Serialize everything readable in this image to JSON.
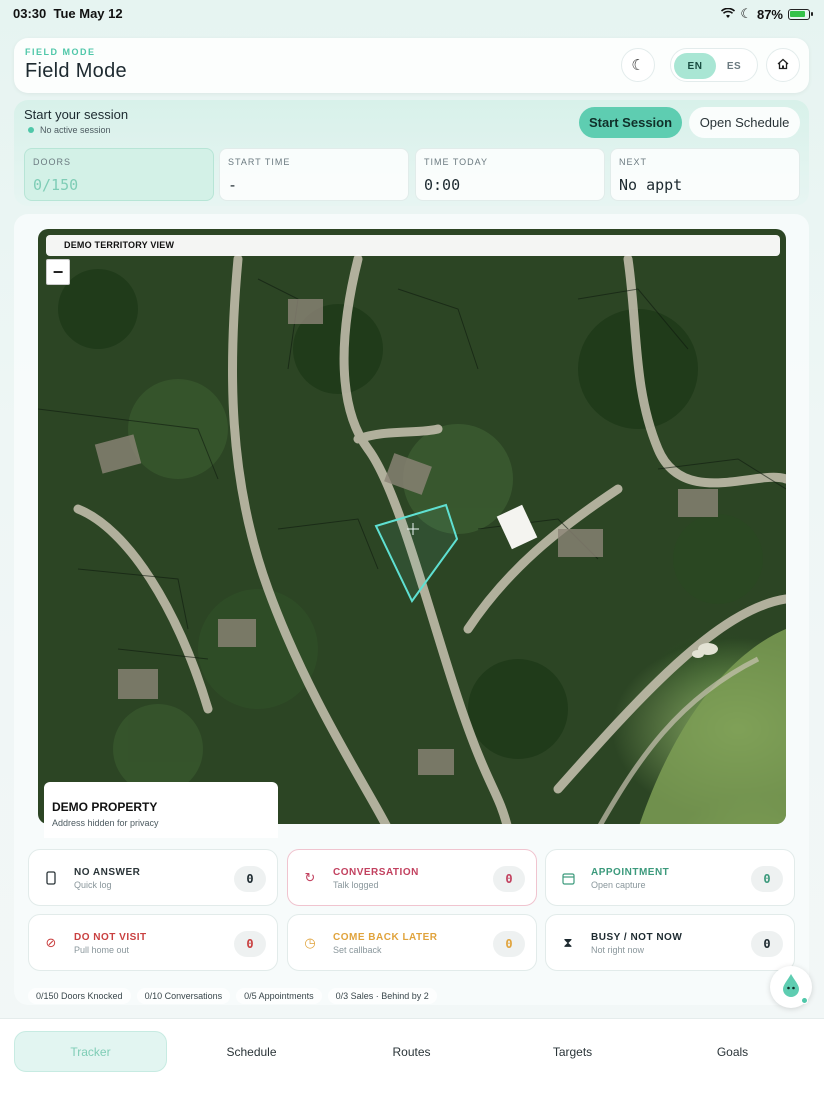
{
  "status_bar": {
    "time": "03:30",
    "date": "Tue May 12",
    "battery": "87%"
  },
  "header": {
    "eyebrow": "FIELD MODE",
    "title": "Field Mode",
    "lang_options": [
      "EN",
      "ES"
    ],
    "lang_selected": "EN"
  },
  "session": {
    "title": "Start your session",
    "status": "No active session",
    "start_button": "Start Session",
    "schedule_button": "Open Schedule",
    "stats": [
      {
        "label": "DOORS",
        "value": "0/150"
      },
      {
        "label": "START TIME",
        "value": "-"
      },
      {
        "label": "TIME TODAY",
        "value": "0:00"
      },
      {
        "label": "NEXT",
        "value": "No appt"
      }
    ]
  },
  "map": {
    "header": "DEMO TERRITORY VIEW",
    "zoom_out": "−",
    "property_title": "DEMO PROPERTY",
    "property_subtitle": "Address hidden for privacy"
  },
  "outcomes": [
    {
      "title": "NO ANSWER",
      "subtitle": "Quick log",
      "count": "0",
      "color": "#2a3438",
      "icon": "phone-icon"
    },
    {
      "title": "CONVERSATION",
      "subtitle": "Talk logged",
      "count": "0",
      "color": "#c2415f",
      "icon": "refresh-icon"
    },
    {
      "title": "APPOINTMENT",
      "subtitle": "Open capture",
      "count": "0",
      "color": "#3c9a7c",
      "icon": "calendar-icon"
    },
    {
      "title": "DO NOT VISIT",
      "subtitle": "Pull home out",
      "count": "0",
      "color": "#c94040",
      "icon": "block-icon"
    },
    {
      "title": "COME BACK LATER",
      "subtitle": "Set callback",
      "count": "0",
      "color": "#e0a33c",
      "icon": "clock-icon"
    },
    {
      "title": "BUSY / NOT NOW",
      "subtitle": "Not right now",
      "count": "0",
      "color": "#1d2a30",
      "icon": "hourglass-icon"
    }
  ],
  "progress": [
    "0/150 Doors Knocked",
    "0/10 Conversations",
    "0/5 Appointments",
    "0/3 Sales · Behind by 2"
  ],
  "tabs": [
    "Tracker",
    "Schedule",
    "Routes",
    "Targets",
    "Goals"
  ],
  "active_tab": "Tracker"
}
